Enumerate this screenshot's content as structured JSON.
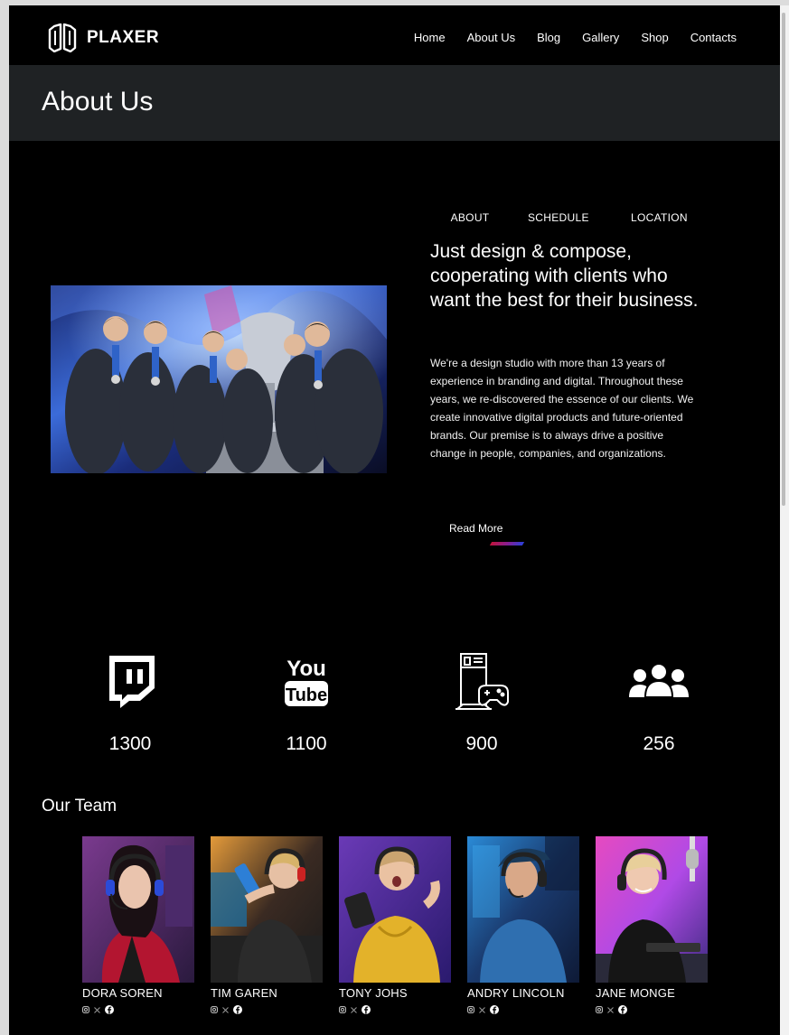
{
  "brand": {
    "name": "PLAXER"
  },
  "nav": [
    "Home",
    "About Us",
    "Blog",
    "Gallery",
    "Shop",
    "Contacts"
  ],
  "page_title": "About Us",
  "about": {
    "tabs": [
      "ABOUT",
      "SCHEDULE",
      "LOCATION"
    ],
    "active_tab": "ABOUT",
    "heading": "Just design & compose, cooperating with clients who want the best for their business.",
    "body": "We're a design studio with more than 13 years of experience in branding and digital. Throughout these years, we re-discovered the essence of our clients. We create innovative digital products and future-oriented brands. Our premise is to always drive a positive change in people, companies, and organizations.",
    "read_more": "Read More"
  },
  "stats": [
    {
      "icon": "twitch-icon",
      "value": "1300"
    },
    {
      "icon": "youtube-icon",
      "value": "1100"
    },
    {
      "icon": "gaming-pc-icon",
      "value": "900"
    },
    {
      "icon": "users-icon",
      "value": "256"
    }
  ],
  "team": {
    "title": "Our Team",
    "members": [
      {
        "name": "DORA SOREN"
      },
      {
        "name": "TIM GAREN"
      },
      {
        "name": "TONY JOHS"
      },
      {
        "name": "ANDRY LINCOLN"
      },
      {
        "name": "JANE MONGE"
      }
    ]
  },
  "colors": {
    "accent_red": "#c0143c",
    "accent_blue": "#2b3fd9",
    "background": "#000000",
    "title_bar": "#1f2224"
  }
}
